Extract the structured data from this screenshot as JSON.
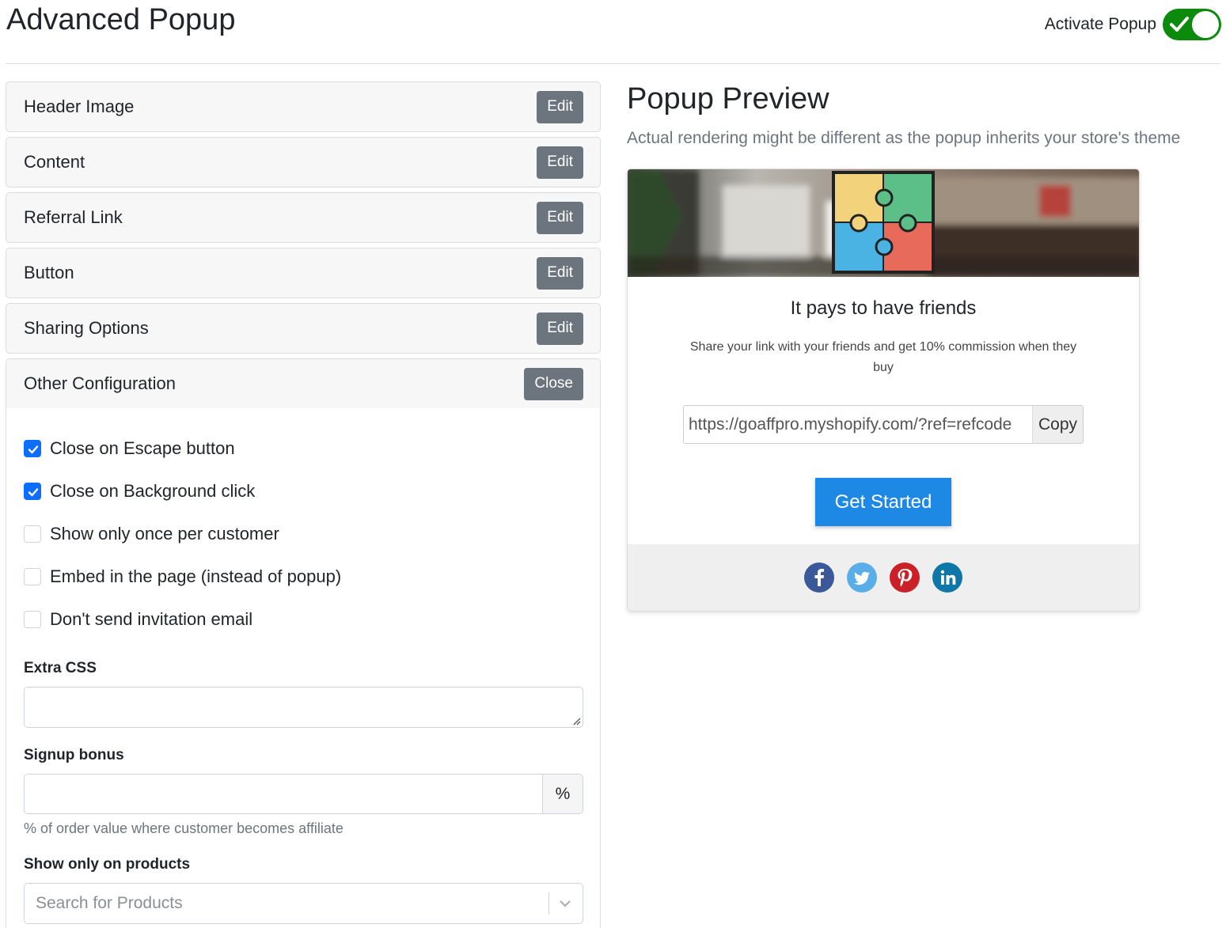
{
  "page": {
    "title": "Advanced Popup"
  },
  "activate": {
    "label": "Activate Popup",
    "enabled": true,
    "color": "#0b8a0b"
  },
  "sections": [
    {
      "label": "Header Image",
      "button": "Edit"
    },
    {
      "label": "Content",
      "button": "Edit"
    },
    {
      "label": "Referral Link",
      "button": "Edit"
    },
    {
      "label": "Button",
      "button": "Edit"
    },
    {
      "label": "Sharing Options",
      "button": "Edit"
    }
  ],
  "other_config": {
    "label": "Other Configuration",
    "button": "Close",
    "checkboxes": [
      {
        "label": "Close on Escape button",
        "checked": true
      },
      {
        "label": "Close on Background click",
        "checked": true
      },
      {
        "label": "Show only once per customer",
        "checked": false
      },
      {
        "label": "Embed in the page (instead of popup)",
        "checked": false
      },
      {
        "label": "Don't send invitation email",
        "checked": false
      }
    ],
    "extra_css": {
      "label": "Extra CSS",
      "value": ""
    },
    "signup_bonus": {
      "label": "Signup bonus",
      "value": "",
      "suffix": "%",
      "help": "% of order value where customer becomes affiliate"
    },
    "show_on_products": {
      "label": "Show only on products",
      "placeholder": "Search for Products"
    }
  },
  "preview": {
    "title": "Popup Preview",
    "subtitle": "Actual rendering might be different as the popup inherits your store's theme",
    "heading": "It pays to have friends",
    "text": "Share your link with your friends and get 10% commission when they buy",
    "ref_link": "https://goaffpro.myshopify.com/?ref=refcode",
    "copy_label": "Copy",
    "cta_label": "Get Started",
    "cta_color": "#1e88e5",
    "social": [
      "facebook-icon",
      "twitter-icon",
      "pinterest-icon",
      "linkedin-icon"
    ]
  },
  "colors": {
    "primary": "#0d6efd",
    "secondary": "#6c757d"
  }
}
